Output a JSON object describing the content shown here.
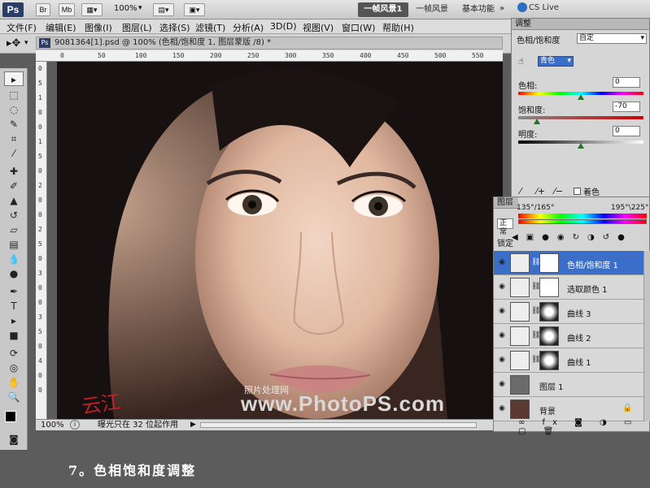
{
  "app": {
    "logo": "Ps",
    "bridge_btn": "Br",
    "mini_btn": "Mb",
    "zoom": "100%",
    "workspaces": {
      "active": "一帧风景1",
      "item2": "一帧风景",
      "item3": "基本功能"
    },
    "cslive": "CS Live"
  },
  "menu": [
    "文件(F)",
    "编辑(E)",
    "图像(I)",
    "图层(L)",
    "选择(S)",
    "滤镜(T)",
    "分析(A)",
    "3D(D)",
    "视图(V)",
    "窗口(W)",
    "帮助(H)"
  ],
  "document": {
    "tab_title": "9081364[1].psd @ 100% (色相/饱和度 1, 图层蒙版 /8) *",
    "ruler_top": [
      "0",
      "50",
      "100",
      "150",
      "200",
      "250",
      "300",
      "350",
      "400",
      "450",
      "500",
      "550"
    ],
    "ruler_left": [
      "0",
      "5",
      "1",
      "0",
      "0",
      "1",
      "5",
      "0",
      "2",
      "0",
      "0",
      "2",
      "5",
      "0",
      "3",
      "0",
      "0",
      "3",
      "5",
      "0",
      "4",
      "0",
      "0"
    ],
    "watermark_small": "照片处理网",
    "watermark_large": "www.PhotoPS.com",
    "signature": "云江",
    "status_zoom": "100%",
    "status_text": "曝光只在 32 位起作用"
  },
  "adjustments": {
    "title": "调整",
    "preset_label": "色相/饱和度",
    "preset_value": "自定",
    "channel": "青色",
    "hue_label": "色相:",
    "hue_value": "0",
    "sat_label": "饱和度:",
    "sat_value": "-70",
    "light_label": "明度:",
    "light_value": "0",
    "colorize_label": "着色",
    "range_left": "135°/165°",
    "range_right": "195°\\225°",
    "hue_pos": 0.5,
    "sat_pos": 0.15,
    "light_pos": 0.5
  },
  "layers": {
    "title": "图层",
    "blend_mode": "正常",
    "lock_label": "锁定",
    "items": [
      {
        "name": "色相/饱和度 1",
        "selected": true
      },
      {
        "name": "选取颜色 1",
        "selected": false
      },
      {
        "name": "曲线 3",
        "selected": false
      },
      {
        "name": "曲线 2",
        "selected": false
      },
      {
        "name": "曲线 1",
        "selected": false
      },
      {
        "name": "图层 1",
        "selected": false
      },
      {
        "name": "背景",
        "selected": false
      }
    ],
    "footer_icons": [
      "link-icon",
      "fx-icon",
      "mask-icon",
      "adjustment-icon",
      "folder-icon",
      "new-layer-icon",
      "trash-icon"
    ]
  },
  "caption": "7。色相饱和度调整",
  "colors": {
    "accent_selected": "#3a6ec8",
    "ps_blue": "#2b3e66"
  }
}
